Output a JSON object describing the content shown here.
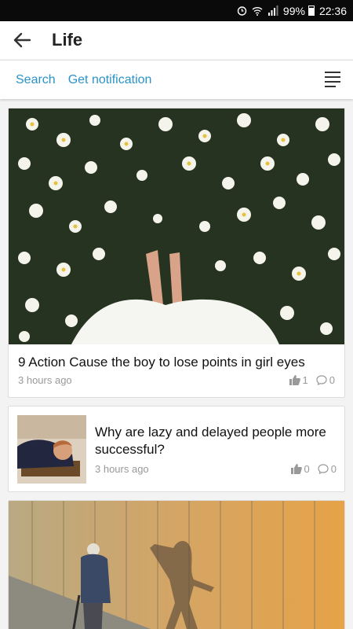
{
  "status": {
    "battery": "99%",
    "time": "22:36"
  },
  "header": {
    "title": "Life"
  },
  "actions": {
    "search": "Search",
    "notify": "Get notification"
  },
  "articles": [
    {
      "title": "9 Action Cause the boy to lose points in girl eyes",
      "time": "3 hours ago",
      "likes": "1",
      "comments": "0"
    },
    {
      "title": "Why are lazy and delayed people more successful?",
      "time": "3 hours ago",
      "likes": "0",
      "comments": "0"
    }
  ]
}
